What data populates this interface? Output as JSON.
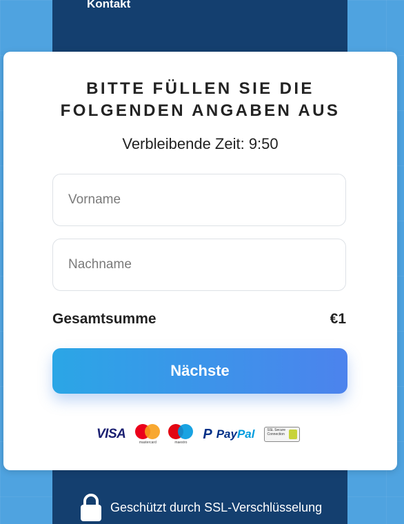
{
  "header": {
    "nav_link": "Kontakt"
  },
  "form": {
    "title_line1": "BITTE FÜLLEN SIE DIE",
    "title_line2": "FOLGENDEN ANGABEN AUS",
    "timer": "Verbleibende Zeit: 9:50",
    "first_name_placeholder": "Vorname",
    "first_name_value": "",
    "last_name_placeholder": "Nachname",
    "last_name_value": "",
    "total_label": "Gesamtsumme",
    "total_value": "€1",
    "next_button_label": "Nächste"
  },
  "payment": {
    "visa": "VISA",
    "mastercard_caption": "mastercard",
    "maestro_caption": "maestro",
    "paypal_part1": "Pay",
    "paypal_part2": "Pal",
    "ssl_badge": "SSL Secure Connection"
  },
  "footer": {
    "ssl_text": "Geschützt durch SSL-Verschlüsselung"
  },
  "colors": {
    "background": "#4fa3e0",
    "dark_column": "#143f6f",
    "button_gradient_start": "#2ba6e6",
    "button_gradient_end": "#4c83ed"
  }
}
